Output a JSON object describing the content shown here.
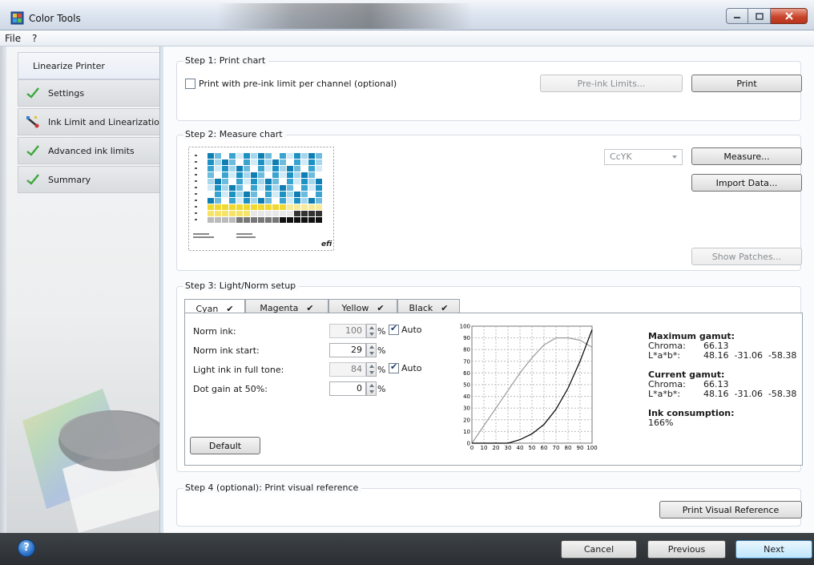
{
  "window": {
    "title": "Color Tools"
  },
  "menu": {
    "file": "File",
    "help": "?"
  },
  "sidebar": {
    "items": [
      {
        "label": "Linearize Printer",
        "icon": "none",
        "active": true
      },
      {
        "label": "Settings",
        "icon": "checkmark-icon"
      },
      {
        "label": "Ink Limit and Linearization",
        "icon": "measuring-device-icon"
      },
      {
        "label": "Advanced ink limits",
        "icon": "checkmark-icon"
      },
      {
        "label": "Summary",
        "icon": "checkmark-icon"
      }
    ]
  },
  "step1": {
    "title": "Step 1: Print chart",
    "checkbox_label": "Print with pre-ink limit per channel (optional)",
    "checkbox_checked": false,
    "preink_button": "Pre-ink Limits...",
    "print_button": "Print"
  },
  "step2": {
    "title": "Step 2: Measure chart",
    "dropdown_value": "CcYK",
    "measure_button": "Measure...",
    "import_button": "Import Data...",
    "show_patches_button": "Show Patches...",
    "chart_logo": "efi"
  },
  "step3": {
    "title": "Step 3: Light/Norm setup",
    "tabs": [
      {
        "label": "Cyan",
        "checked": true
      },
      {
        "label": "Magenta",
        "checked": true
      },
      {
        "label": "Yellow",
        "checked": true
      },
      {
        "label": "Black",
        "checked": true
      }
    ],
    "fields": {
      "norm_ink": {
        "label": "Norm ink:",
        "value": "100",
        "unit": "%",
        "auto_label": "Auto",
        "auto": true
      },
      "norm_ink_start": {
        "label": "Norm ink start:",
        "value": "29",
        "unit": "%"
      },
      "light_ink": {
        "label": "Light ink in full tone:",
        "value": "84",
        "unit": "%",
        "auto_label": "Auto",
        "auto": true
      },
      "dot_gain": {
        "label": "Dot gain at 50%:",
        "value": "0",
        "unit": "%"
      }
    },
    "default_button": "Default",
    "gamut": {
      "max_title": "Maximum gamut:",
      "max_chroma_label": "Chroma:",
      "max_chroma": "66.13",
      "max_lab_label": "L*a*b*:",
      "max_lab": "48.16  -31.06  -58.38",
      "cur_title": "Current gamut:",
      "cur_chroma_label": "Chroma:",
      "cur_chroma": "66.13",
      "cur_lab_label": "L*a*b*:",
      "cur_lab": "48.16  -31.06  -58.38",
      "ink_title": "Ink consumption:",
      "ink_value": "166%"
    }
  },
  "step4": {
    "title": "Step 4 (optional): Print visual reference",
    "button": "Print Visual Reference"
  },
  "footer": {
    "help": "?",
    "cancel": "Cancel",
    "previous": "Previous",
    "next": "Next"
  },
  "chart_data": {
    "type": "line",
    "x_ticks": [
      "0",
      "10",
      "20",
      "30",
      "40",
      "50",
      "60",
      "70",
      "80",
      "90",
      "100"
    ],
    "y_ticks": [
      "0",
      "10",
      "20",
      "30",
      "40",
      "50",
      "60",
      "70",
      "80",
      "90",
      "100"
    ],
    "xlim": [
      0,
      100
    ],
    "ylim": [
      0,
      100
    ],
    "grid": true,
    "series": [
      {
        "color": "#9a9a9a",
        "x": [
          0,
          10,
          20,
          30,
          40,
          50,
          60,
          70,
          80,
          90,
          100
        ],
        "y": [
          0,
          15,
          30,
          45,
          60,
          73,
          84,
          90,
          90,
          88,
          82
        ]
      },
      {
        "color": "#000000",
        "x": [
          0,
          10,
          20,
          30,
          40,
          50,
          60,
          70,
          80,
          90,
          100
        ],
        "y": [
          0,
          0,
          0,
          0,
          3,
          8,
          16,
          29,
          47,
          70,
          97
        ]
      }
    ]
  }
}
